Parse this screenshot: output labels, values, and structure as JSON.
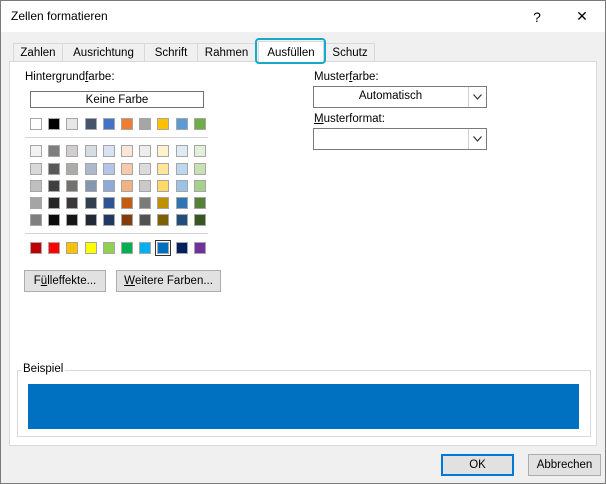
{
  "window": {
    "title": "Zellen formatieren",
    "help_glyph": "?",
    "close_glyph": "✕"
  },
  "tabs": [
    "Zahlen",
    "Ausrichtung",
    "Schrift",
    "Rahmen",
    "Ausfüllen",
    "Schutz"
  ],
  "active_tab": "Ausfüllen",
  "background": {
    "label": "Hintergrundfarbe:",
    "no_color_label": "Keine Farbe",
    "selected_color": "#0070c0",
    "standard_row": [
      "#ffffff",
      "#000000",
      "#e7e6e6",
      "#44546a",
      "#4472c4",
      "#ed7d31",
      "#a5a5a5",
      "#ffc000",
      "#5b9bd5",
      "#70ad47"
    ],
    "tint_rows": [
      [
        "#f2f2f2",
        "#7f7f7f",
        "#d0cece",
        "#d6dce4",
        "#d9e2f3",
        "#fbe5d5",
        "#ededed",
        "#fff2cc",
        "#deebf6",
        "#e2efd9"
      ],
      [
        "#d8d8d8",
        "#595959",
        "#aeabab",
        "#adb9ca",
        "#b4c6e7",
        "#f7caac",
        "#dbdbdb",
        "#fee599",
        "#bdd7ee",
        "#c5e0b3"
      ],
      [
        "#bfbfbf",
        "#3f3f3f",
        "#757070",
        "#8496b0",
        "#8eaadb",
        "#f4b183",
        "#c9c9c9",
        "#ffd965",
        "#9cc3e5",
        "#a8d08d"
      ],
      [
        "#a5a5a5",
        "#262626",
        "#3a3838",
        "#323f4f",
        "#2f5496",
        "#c55a11",
        "#7b7b7b",
        "#bf9000",
        "#2e75b5",
        "#538135"
      ],
      [
        "#7f7f7f",
        "#0c0c0c",
        "#171616",
        "#222a35",
        "#1f3864",
        "#833c0b",
        "#525252",
        "#7f6000",
        "#1e4e79",
        "#375623"
      ]
    ],
    "accent_row": [
      "#c00000",
      "#ff0000",
      "#ffc000",
      "#ffff00",
      "#92d050",
      "#00b050",
      "#00b0f0",
      "#0070c0",
      "#002060",
      "#7030a0"
    ],
    "fill_effects_label": "Fülleffekte...",
    "more_colors_label": "Weitere Farben..."
  },
  "pattern": {
    "color_label": "Musterfarbe:",
    "color_value": "Automatisch",
    "style_label": "Musterformat:",
    "style_value": ""
  },
  "sample": {
    "label": "Beispiel",
    "color": "#0070c0"
  },
  "footer": {
    "ok_label": "OK",
    "cancel_label": "Abbrechen"
  }
}
